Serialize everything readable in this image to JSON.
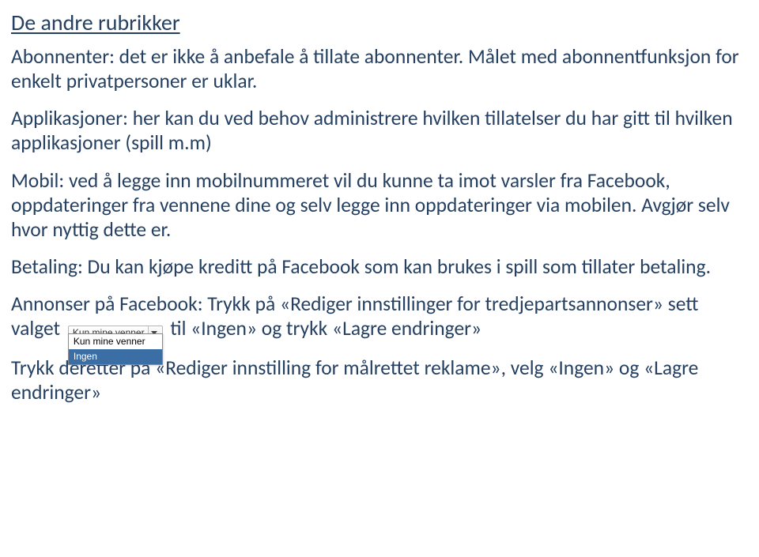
{
  "heading": "De andre rubrikker",
  "paragraphs": {
    "p1": "Abonnenter: det er ikke å anbefale å tillate abonnenter. Målet med abonnentfunksjon for enkelt privatpersoner er uklar.",
    "p2": "Applikasjoner: her kan du ved behov administrere hvilken tillatelser du har gitt til hvilken applikasjoner (spill m.m)",
    "p3": "Mobil: ved å legge inn mobilnummeret vil du kunne ta imot varsler fra Facebook, oppdateringer fra vennene dine og selv legge inn oppdateringer via mobilen. Avgjør selv hvor nyttig dette er.",
    "p4": "Betaling: Du kan kjøpe kreditt på Facebook som kan brukes i spill som tillater betaling.",
    "p5a": "Annonser på Facebook: Trykk på «Rediger innstillinger for tredjepartsannonser» sett valget ",
    "p5b": " til «Ingen» og trykk «Lagre endringer»",
    "p6": "Trykk deretter på «Rediger innstilling for målrettet reklame», velg «Ingen» og «Lagre endringer»"
  },
  "dropdown": {
    "selected": "Kun mine venner",
    "options": [
      "Kun mine venner",
      "Ingen"
    ],
    "highlight_index": 1
  }
}
